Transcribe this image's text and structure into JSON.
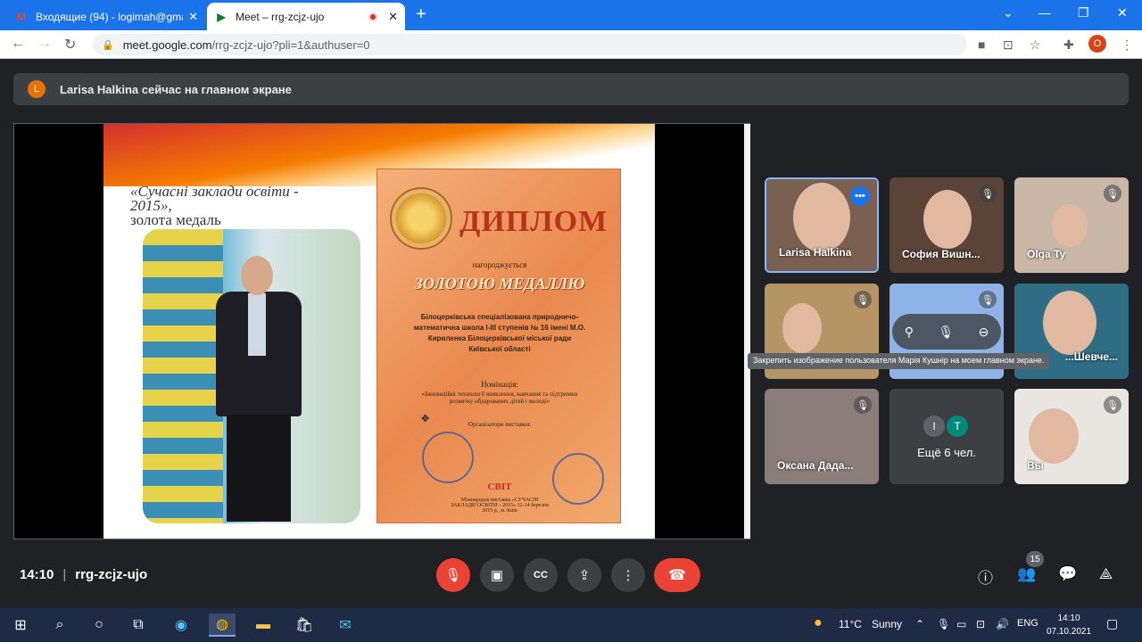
{
  "browser": {
    "tabs": [
      {
        "title": "Входящие (94) - logimah@gmai",
        "favicon": "M",
        "close": "✕"
      },
      {
        "title": "Meet – rrg-zcjz-ujo",
        "favicon": "▶",
        "close": "✕"
      }
    ],
    "new_tab": "+",
    "window": {
      "menu": "⌄",
      "minimize": "—",
      "restore": "❐",
      "close": "✕"
    },
    "url_host": "meet.google.com",
    "url_path": "/rrg-zcjz-ujo?pli=1&authuser=0",
    "profile_initial": "O"
  },
  "banner": {
    "avatar_initial": "L",
    "text": "Larisa Halkina сейчас на главном экране"
  },
  "slide": {
    "line1": "«Сучасні заклади освіти -",
    "line2": "2015»,",
    "line3": "золота медаль",
    "diploma_title": "ДИПЛОМ",
    "awarded": "нагороджується",
    "medal": "ЗОЛОТОЮ МЕДАЛЛЮ",
    "school": "Білоцерківська спеціалізована природничо-математична школа І-ІІІ ступенів № 16 імені М.О. Кириленка Білоцерківської міської ради Київської області",
    "nomination_label": "Номінація:",
    "nomination": "«Інноваційні технології виявлення, навчання та підтримки розвитку обдарованих дітей і молоді»",
    "organizers": "Організатори виставки:",
    "brand": "СВІТ",
    "footer": "Міжнародна виставка «СУЧАСНІ ЗАКЛАДИ ОСВІТИ – 2015» 12-14 березня 2015 р., м. Київ"
  },
  "participants": [
    {
      "name": "Larisa Halkina",
      "speaking": true,
      "bg": "#7a6050"
    },
    {
      "name": "София Вишн...",
      "muted": true,
      "bg": "#5a4438"
    },
    {
      "name": "Olga Ty",
      "muted": true,
      "bg": "#c9b8a8"
    },
    {
      "name": "",
      "muted": true,
      "bg": "#b59566"
    },
    {
      "name": "",
      "muted": true,
      "bg": "#8fb3e6"
    },
    {
      "name": "...Шевче...",
      "muted": false,
      "bg": "#2f6d85"
    },
    {
      "name": "Оксана Дада...",
      "muted": true,
      "bg": "#8a7d7a"
    },
    {
      "name": "Вы",
      "muted": true,
      "bg": "#e9e6e2"
    }
  ],
  "more": {
    "initials": [
      "I",
      "T"
    ],
    "colors": [
      "#5f6368",
      "#00897b"
    ],
    "label": "Ещё 6 чел."
  },
  "hover_actions": {
    "pin": "⚲",
    "mute": "🎙",
    "remove": "⊖"
  },
  "tooltip": "Закрепить изображение пользователя Марія Кушнір на моем главном экране.",
  "bottom": {
    "time": "14:10",
    "separator": "|",
    "code": "rrg-zcjz-ujo",
    "people_count": "15"
  },
  "taskbar": {
    "weather_temp": "11°C",
    "weather_text": "Sunny",
    "lang": "ENG",
    "time": "14:10",
    "date": "07.10.2021"
  },
  "colors": {
    "accent": "#1a73e8",
    "danger": "#ea4335",
    "meet_bg": "#202124"
  }
}
